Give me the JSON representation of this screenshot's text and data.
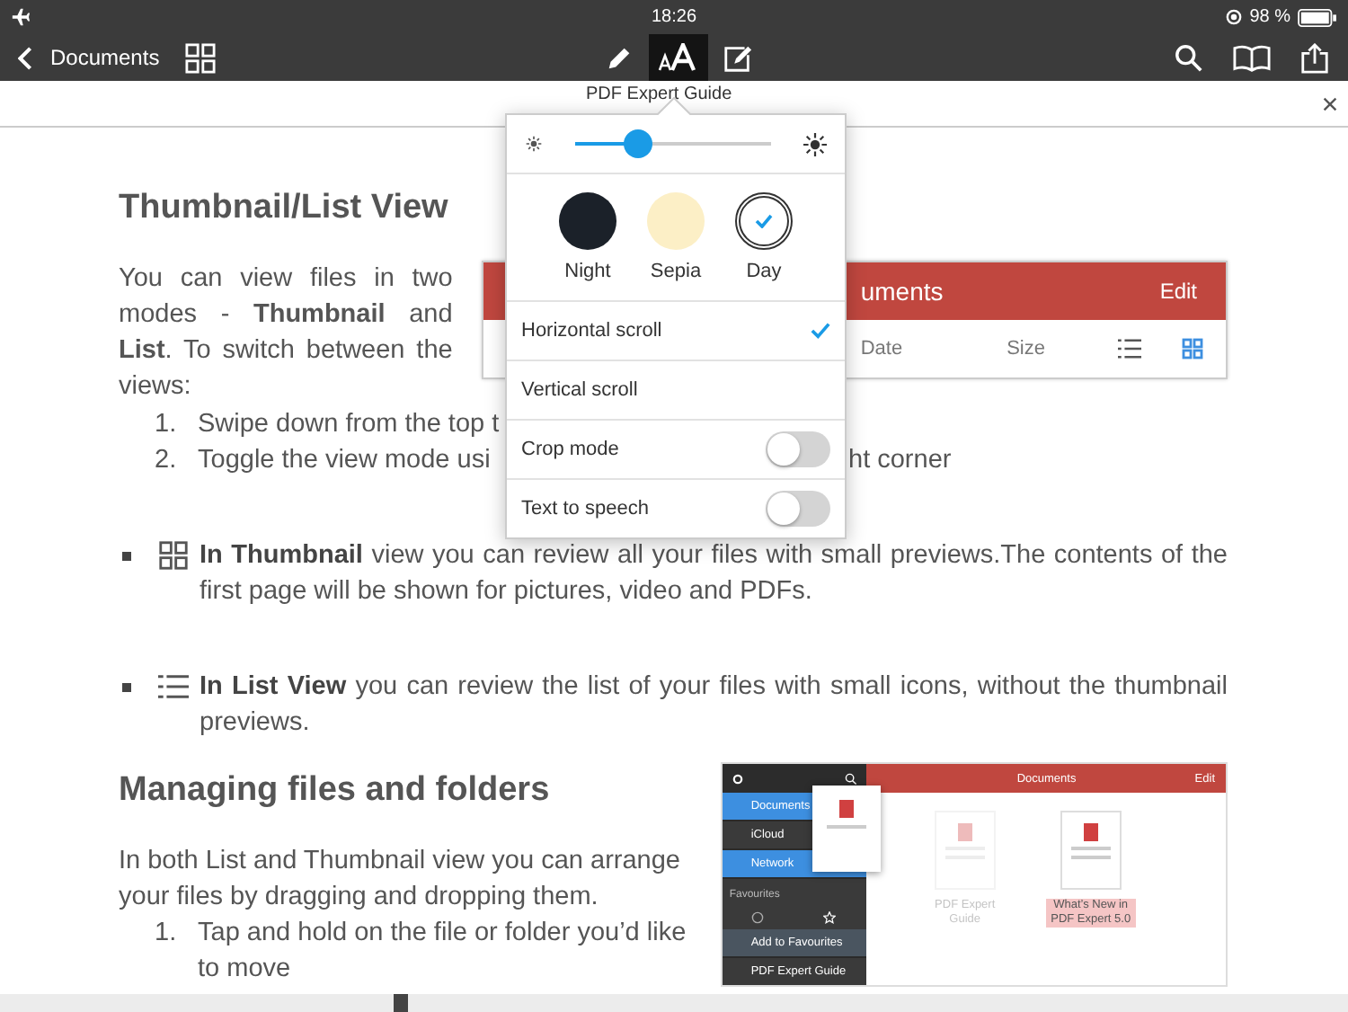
{
  "status_bar": {
    "time": "18:26",
    "battery": "98 %"
  },
  "toolbar": {
    "back_label": "Documents",
    "text_button_selected": true
  },
  "document_title": "PDF Expert Guide",
  "popover": {
    "brightness": {
      "level": 0.28
    },
    "themes": [
      {
        "label": "Night",
        "color": "#1b2129",
        "selected": false
      },
      {
        "label": "Sepia",
        "color": "#fcefc6",
        "selected": false
      },
      {
        "label": "Day",
        "color": "#ffffff",
        "selected": true
      }
    ],
    "options": [
      {
        "kind": "check",
        "label": "Horizontal scroll",
        "selected": true
      },
      {
        "kind": "check",
        "label": "Vertical scroll",
        "selected": false
      },
      {
        "kind": "toggle",
        "label": "Crop mode",
        "on": false
      },
      {
        "kind": "toggle",
        "label": "Text to speech",
        "on": false
      }
    ]
  },
  "page": {
    "heading_1": "Thumbnail/List View",
    "intro": "You can view files in two modes - **Thumbnail** and **List**. To switch between the views:",
    "steps": [
      {
        "number": "1.",
        "text": "Swipe down from the top t"
      },
      {
        "number": "2.",
        "text": "Toggle the view mode usi",
        "text_after": "ht corner"
      }
    ],
    "inset_1": {
      "title": "uments",
      "edit": "Edit",
      "columns": [
        "Date",
        "Size"
      ]
    },
    "bullets": [
      {
        "kind": "grid",
        "text": "**In Thumbnail** view you can review all your files with small previews.The contents of the first page will be shown for pictures, video and PDFs."
      },
      {
        "kind": "list",
        "text": "**In List View** you can review the list of your files with small icons, without the thumbnail previews."
      }
    ],
    "heading_2": "Managing files and folders",
    "para_2": "In both List and Thumbnail view you can arrange your files by dragging and dropping them.",
    "steps_2": [
      {
        "number": "1.",
        "text": "Tap and hold on the file or folder you’d like to move"
      }
    ],
    "inset_2": {
      "sidebar": [
        {
          "label": "Documents",
          "selected": true
        },
        {
          "label": "iCloud",
          "selected": false
        },
        {
          "label": "Network",
          "selected": true
        }
      ],
      "favourites": "Favourites",
      "add": "Add to Favourites",
      "guide": "PDF Expert Guide",
      "header": "Documents",
      "edit": "Edit",
      "files": [
        {
          "name": "PDF Expert Guide",
          "faded": true
        },
        {
          "name": "What’s New in PDF Expert 5.0",
          "faded": false
        }
      ]
    }
  }
}
